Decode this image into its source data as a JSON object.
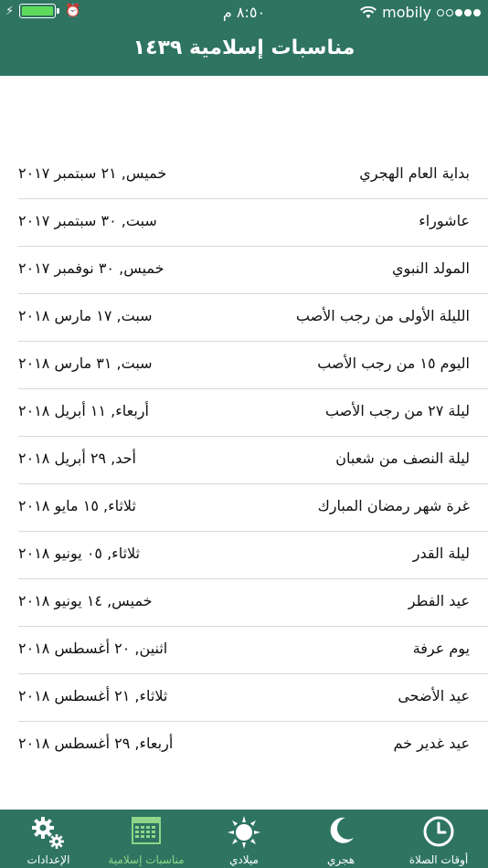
{
  "status_bar": {
    "carrier": "mobily",
    "time": "٨:٥٠ م"
  },
  "header": {
    "title": "مناسبات إسلامية ١٤٣٩"
  },
  "events": [
    {
      "name": "بداية العام الهجري",
      "date": "خميس, ٢١ سبتمبر ٢٠١٧"
    },
    {
      "name": "عاشوراء",
      "date": "سبت, ٣٠ سبتمبر ٢٠١٧"
    },
    {
      "name": "المولد النبوي",
      "date": "خميس, ٣٠ نوفمبر ٢٠١٧"
    },
    {
      "name": "الليلة الأولى من رجب الأصب",
      "date": "سبت, ١٧ مارس ٢٠١٨"
    },
    {
      "name": "اليوم ١٥ من رجب الأصب",
      "date": "سبت, ٣١ مارس ٢٠١٨"
    },
    {
      "name": "ليلة ٢٧ من رجب الأصب",
      "date": "أربعاء, ١١ أبريل ٢٠١٨"
    },
    {
      "name": "ليلة النصف من شعبان",
      "date": "أحد, ٢٩ أبريل ٢٠١٨"
    },
    {
      "name": "غرة شهر رمضان المبارك",
      "date": "ثلاثاء, ١٥ مايو ٢٠١٨"
    },
    {
      "name": "ليلة القدر",
      "date": "ثلاثاء, ٠٥ يونيو ٢٠١٨"
    },
    {
      "name": "عيد الفطر",
      "date": "خميس, ١٤ يونيو ٢٠١٨"
    },
    {
      "name": "يوم عرفة",
      "date": "اثنين, ٢٠ أغسطس ٢٠١٨"
    },
    {
      "name": "عيد الأضحى",
      "date": "ثلاثاء, ٢١ أغسطس ٢٠١٨"
    },
    {
      "name": "عيد غدير خم",
      "date": "أربعاء, ٢٩ أغسطس ٢٠١٨"
    }
  ],
  "tabs": [
    {
      "label": "الإعدادات",
      "icon": "gear-icon"
    },
    {
      "label": "مناسبات إسلامية",
      "icon": "calendar-icon"
    },
    {
      "label": "ميلادي",
      "icon": "sun-icon"
    },
    {
      "label": "هجري",
      "icon": "moon-icon"
    },
    {
      "label": "أوقات الصلاة",
      "icon": "clock-icon"
    }
  ],
  "colors": {
    "primary": "#2e7461",
    "active_tab": "#8fd68a"
  }
}
